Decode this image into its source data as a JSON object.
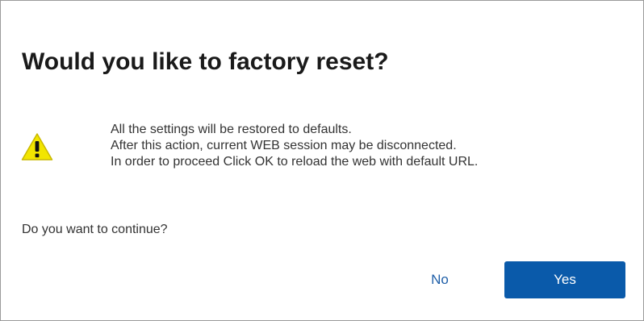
{
  "dialog": {
    "title": "Would you like to factory reset?",
    "icon": "warning-triangle-icon",
    "message_lines": [
      "All the settings will be restored to defaults.",
      "After this action, current WEB session may be disconnected.",
      "In order to proceed Click OK to reload the web with default URL."
    ],
    "question": "Do you want to continue?",
    "buttons": {
      "no_label": "No",
      "yes_label": "Yes"
    }
  },
  "colors": {
    "primary_button": "#0a5aaa",
    "link_button": "#1f5fa8",
    "warning_fill": "#f2e500",
    "border": "#9a9a9a"
  }
}
